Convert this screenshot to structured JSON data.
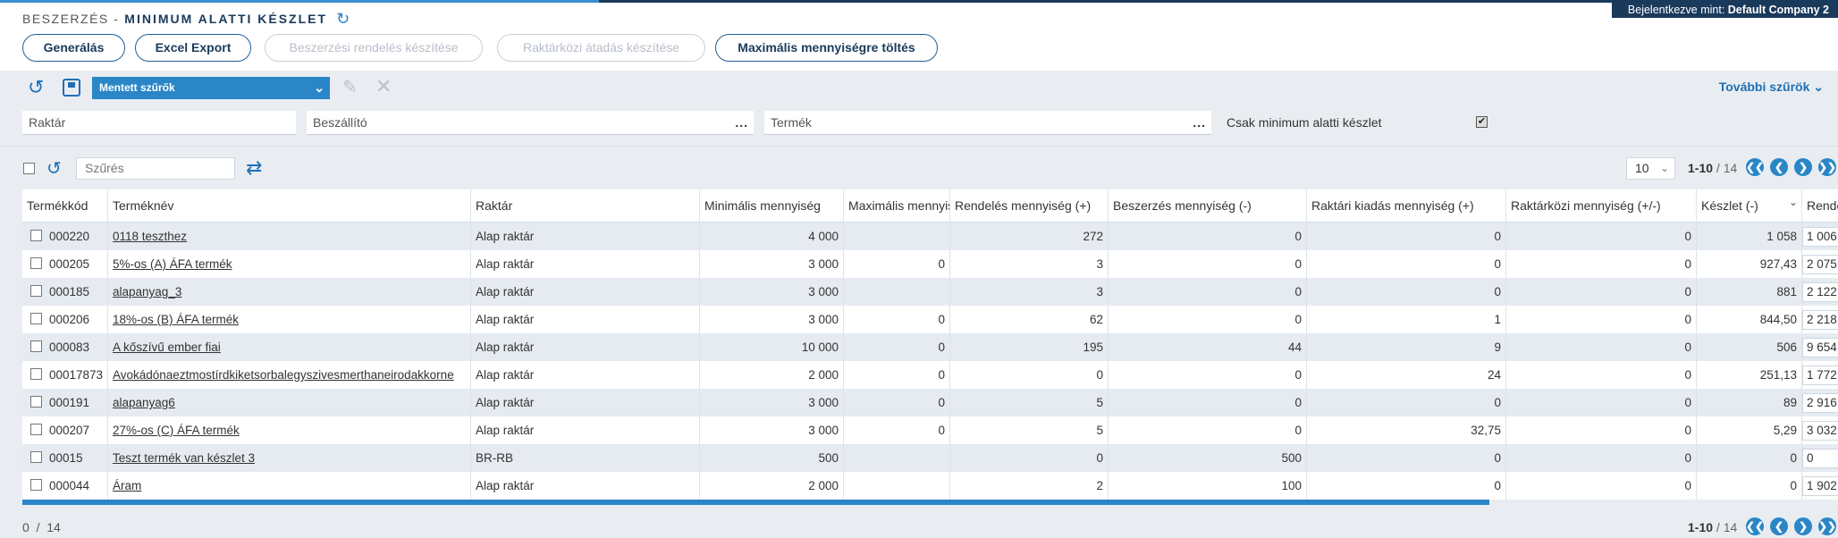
{
  "header": {
    "section": "BESZERZÉS -",
    "title": "MINIMUM ALATTI KÉSZLET",
    "user_label": "Bejelentkezve mint:",
    "user_company": "Default Company 2"
  },
  "actions": [
    {
      "label": "Generálás",
      "enabled": true
    },
    {
      "label": "Excel Export",
      "enabled": true
    },
    {
      "label": "Beszerzési rendelés készítése",
      "enabled": false
    },
    {
      "label": "Raktárközi átadás készítése",
      "enabled": false
    },
    {
      "label": "Maximális mennyiségre töltés",
      "enabled": true
    }
  ],
  "filters": {
    "saved_filters": "Mentett szűrők",
    "more_filters": "További szűrök",
    "warehouse_placeholder": "Raktár",
    "supplier_placeholder": "Beszállító",
    "product_placeholder": "Termék",
    "below_min_label": "Csak minimum alatti készlet",
    "below_min_checked": true,
    "search_placeholder": "Szűrés"
  },
  "pagination": {
    "page_size": "10",
    "range": "1-10",
    "total": "/ 14"
  },
  "table": {
    "columns": [
      "Termékkód",
      "Terméknév",
      "Raktár",
      "Minimális mennyiség",
      "Maximális mennyiség",
      "Rendelés mennyiség (+)",
      "Beszerzés mennyiség (-)",
      "Raktári kiadás mennyiség (+)",
      "Raktárközi mennyiség (+/-)",
      "Készlet (-)",
      "Rendelendő"
    ],
    "rows": [
      [
        "000220",
        "0118 teszthez",
        "Alap raktár",
        "4 000",
        "",
        "272",
        "0",
        "0",
        "0",
        "1 058",
        "1 006"
      ],
      [
        "000205",
        "5%-os (A) ÁFA termék",
        "Alap raktár",
        "3 000",
        "0",
        "3",
        "0",
        "0",
        "0",
        "927,43",
        "2 075"
      ],
      [
        "000185",
        "alapanyag_3",
        "Alap raktár",
        "3 000",
        "",
        "3",
        "0",
        "0",
        "0",
        "881",
        "2 122"
      ],
      [
        "000206",
        "18%-os (B) ÁFA termék",
        "Alap raktár",
        "3 000",
        "0",
        "62",
        "0",
        "1",
        "0",
        "844,50",
        "2 218"
      ],
      [
        "000083",
        "A kőszívű ember fiai",
        "Alap raktár",
        "10 000",
        "0",
        "195",
        "44",
        "9",
        "0",
        "506",
        "9 654"
      ],
      [
        "00017873",
        "Avokádónaeztmostírdkiketsorbalegyszivesmerthaneirodakkorne",
        "Alap raktár",
        "2 000",
        "0",
        "0",
        "0",
        "24",
        "0",
        "251,13",
        "1 772"
      ],
      [
        "000191",
        "alapanyag6",
        "Alap raktár",
        "3 000",
        "0",
        "5",
        "0",
        "0",
        "0",
        "89",
        "2 916"
      ],
      [
        "000207",
        "27%-os (C) ÁFA termék",
        "Alap raktár",
        "3 000",
        "0",
        "5",
        "0",
        "32,75",
        "0",
        "5,29",
        "3 032"
      ],
      [
        "00015",
        "Teszt termék van készlet 3",
        "BR-RB",
        "500",
        "",
        "0",
        "500",
        "0",
        "0",
        "0",
        "0"
      ],
      [
        "000044",
        "Áram",
        "Alap raktár",
        "2 000",
        "",
        "2",
        "100",
        "0",
        "0",
        "0",
        "1 902"
      ]
    ]
  },
  "footer": {
    "selected": "0",
    "separator": "/",
    "total": "14"
  }
}
